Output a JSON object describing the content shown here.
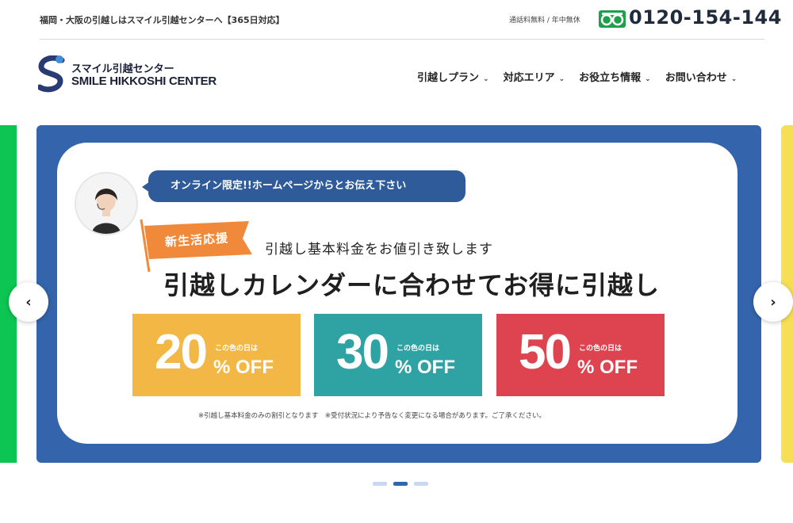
{
  "topbar": {
    "tagline": "福岡・大阪の引越しはスマイル引越センターへ【365日対応】",
    "tel_note": "通話料無料 / 年中無休",
    "phone": "0120-154-144"
  },
  "logo": {
    "jp": "スマイル引越センター",
    "en": "SMILE HIKKOSHI CENTER"
  },
  "nav": [
    {
      "label": "引越しプラン"
    },
    {
      "label": "対応エリア"
    },
    {
      "label": "お役立ち情報"
    },
    {
      "label": "お問い合わせ"
    }
  ],
  "slide": {
    "bubble": "オンライン限定!!ホームページからとお伝え下さい",
    "flag": "新生活応援",
    "sub_heading": "引越し基本料金をお値引き致します",
    "main_heading": "引越しカレンダーに合わせてお得に引越し",
    "boxes": [
      {
        "pct": "20",
        "small": "この色の日は",
        "off": "% OFF",
        "color": "#f2b744"
      },
      {
        "pct": "30",
        "small": "この色の日は",
        "off": "% OFF",
        "color": "#2fa3a3"
      },
      {
        "pct": "50",
        "small": "この色の日は",
        "off": "% OFF",
        "color": "#de4450"
      }
    ],
    "note": "※引越し基本料金のみの割引となります　※受付状況により予告なく変更になる場合があります。ご了承ください。"
  },
  "colors": {
    "slide_bg": "#3464ab",
    "accent": "#2f5b9a",
    "flag": "#f08a3a",
    "free_dial": "#1ea04a"
  },
  "carousel": {
    "prev": "‹",
    "next": "›",
    "dot_count": 3,
    "active_index": 1
  }
}
